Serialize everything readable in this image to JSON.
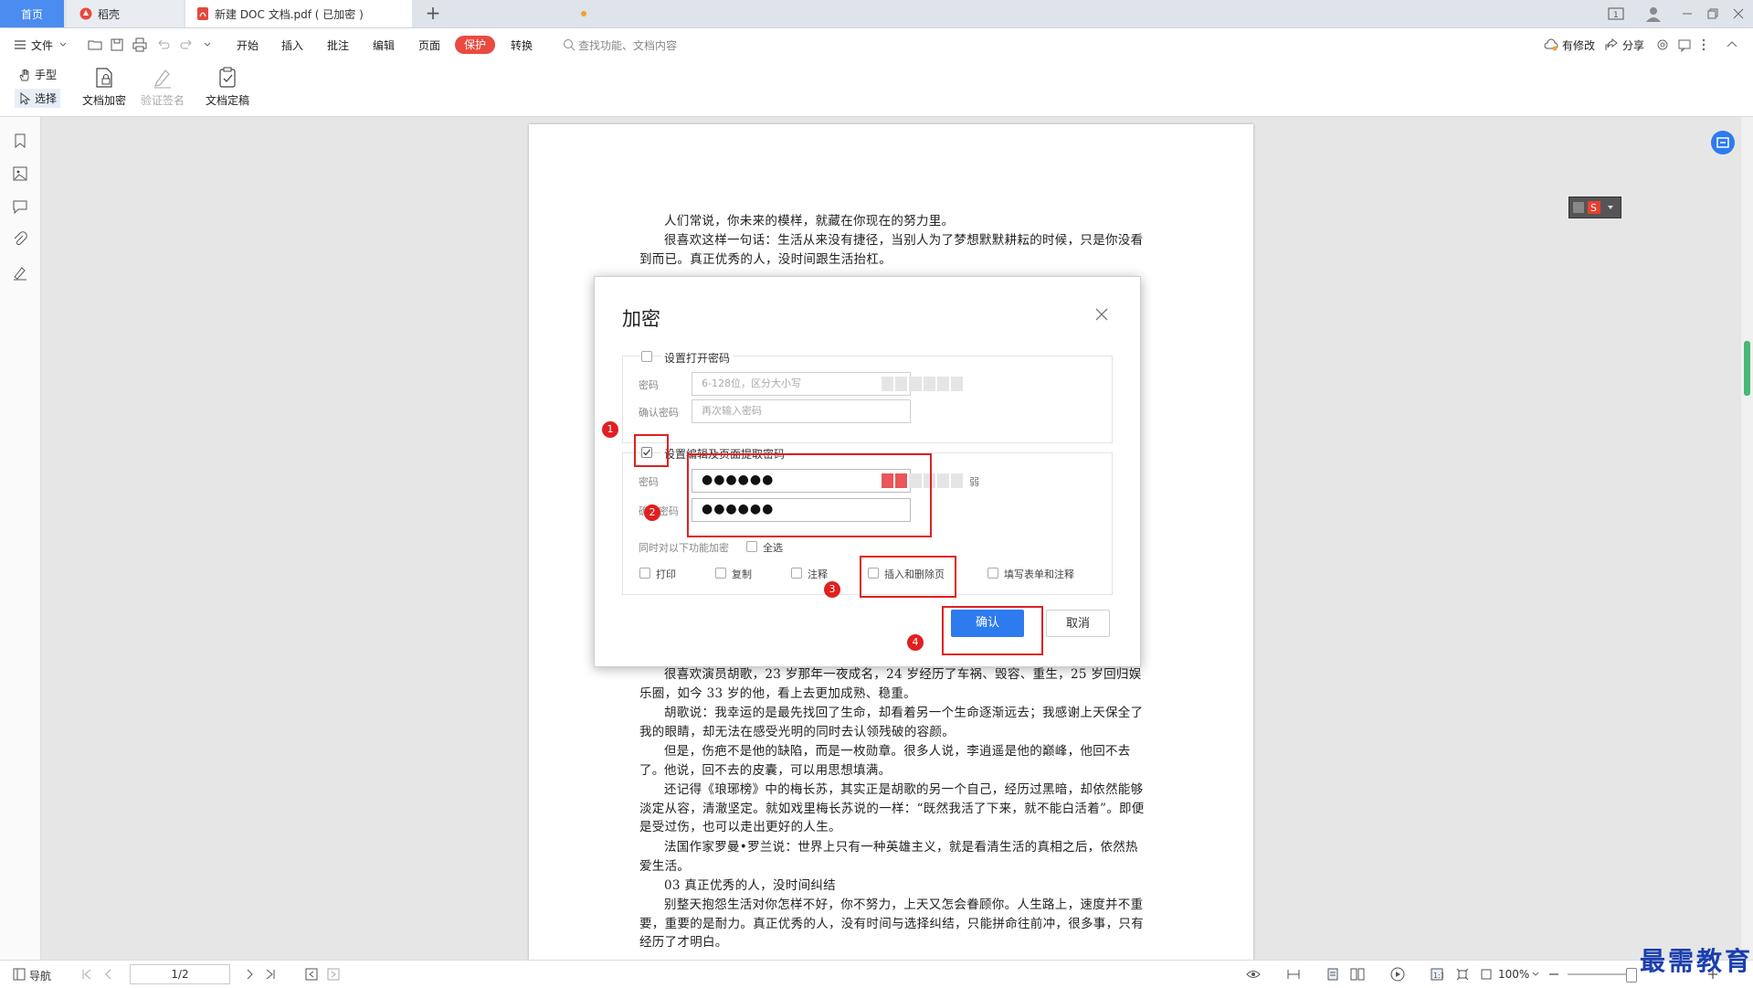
{
  "tabs": {
    "home": "首页",
    "daoke": "稻壳",
    "doc": "新建 DOC 文档.pdf ( 已加密 )",
    "new_tab": "+"
  },
  "menu": {
    "file": "文件",
    "items": [
      "开始",
      "插入",
      "批注",
      "编辑",
      "页面"
    ],
    "protect": "保护",
    "convert": "转换",
    "search_placeholder": "查找功能、文档内容",
    "modified": "有修改",
    "share": "分享"
  },
  "ribbon": {
    "hand": "手型",
    "select": "选择",
    "encrypt": "文档加密",
    "verify_sign": "验证签名",
    "finalize": "文档定稿"
  },
  "document": {
    "paragraphs_top": [
      "人们常说，你未来的模样，就藏在你现在的努力里。",
      "很喜欢这样一句话：生活从来没有捷径，当别人为了梦想默默耕耘的时候，只是你没看到而已。真正优秀的人，没时间跟生活抬杠。"
    ],
    "paragraphs_bottom": [
      "很喜欢演员胡歌，23 岁那年一夜成名，24 岁经历了车祸、毁容、重生，25 岁回归娱乐圈，如今 33 岁的他，看上去更加成熟、稳重。",
      "胡歌说：我幸运的是最先找回了生命，却看着另一个生命逐渐远去；我感谢上天保全了我的眼睛，却无法在感受光明的同时去认领残破的容颜。",
      "但是，伤疤不是他的缺陷，而是一枚勋章。很多人说，李逍遥是他的巅峰，他回不去了。",
      "他说，回不去的皮囊，可以用思想填满。",
      "还记得《琅琊榜》中的梅长苏，其实正是胡歌的另一个自己，经历过黑暗，却依然能够淡定从容，清澈坚定。就如戏里梅长苏说的一样：“既然我活了下来，就不能白活着”。即便是受过伤，也可以走出更好的人生。",
      "法国作家罗曼•罗兰说：世界上只有一种英雄主义，就是看清生活的真相之后，依然热爱生活。",
      "03 真正优秀的人，没时间纠结",
      "别整天抱怨生活对你怎样不好，你不努力，上天又怎会眷顾你。人生路上，速度并不重要，重要的是耐力。真正优秀的人，没有时间与选择纠结，只能拼命往前冲，很多事，只有经历了才明白。"
    ]
  },
  "dialog": {
    "title": "加密",
    "open_pw_label": "设置打开密码",
    "password_label": "密码",
    "confirm_label": "确认密码",
    "pw_placeholder": "6-128位，区分大小写",
    "confirm_placeholder": "再次输入密码",
    "edit_pw_label": "设置编辑及页面提取密码",
    "edit_pw_value": "●●●●●●",
    "edit_confirm_value": "●●●●●●",
    "strength_label": "弱",
    "also_encrypt_label": "同时对以下功能加密",
    "select_all": "全选",
    "options": [
      "打印",
      "复制",
      "注释",
      "插入和删除页",
      "填写表单和注释"
    ],
    "ok": "确认",
    "cancel": "取消"
  },
  "annotations": [
    "1",
    "2",
    "3",
    "4"
  ],
  "status": {
    "nav": "导航",
    "page": "1/2",
    "zoom": "100%"
  },
  "watermark": "最需教育",
  "colors": {
    "accent": "#2d7bef",
    "protect": "#ea4a3f",
    "annotation": "#e02020",
    "strength_weak": "#e8555a"
  }
}
